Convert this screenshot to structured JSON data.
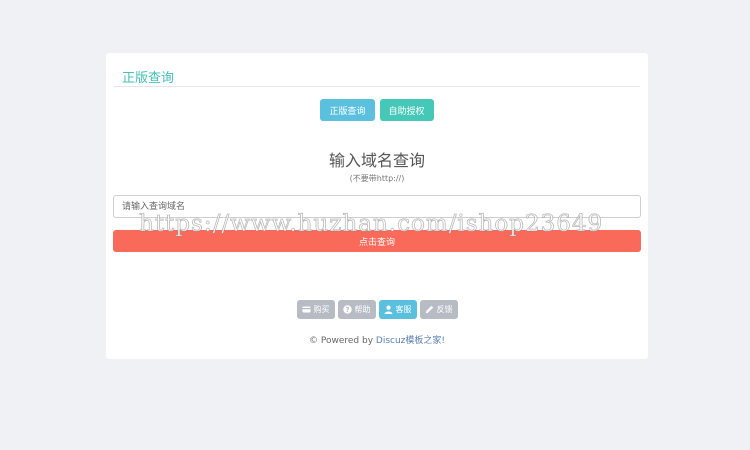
{
  "panel": {
    "title": "正版查询"
  },
  "tabs": [
    {
      "label": "正版查询"
    },
    {
      "label": "自助授权"
    }
  ],
  "query": {
    "heading": "输入域名查询",
    "hint": "(不要带http://)",
    "placeholder": "请输入查询域名",
    "value": "",
    "submit_label": "点击查询"
  },
  "footer": {
    "links": [
      {
        "label": "购买",
        "icon": "card-icon"
      },
      {
        "label": "帮助",
        "icon": "question-icon"
      },
      {
        "label": "客服",
        "icon": "user-icon"
      },
      {
        "label": "反馈",
        "icon": "pencil-icon"
      }
    ],
    "powered_prefix": "© Powered by ",
    "powered_brand": "Discuz模板之家!"
  },
  "watermark": "https://www.huzhan.com/ishop23649",
  "colors": {
    "page_bg": "#f0f1f5",
    "title": "#46bfb5",
    "tab_query": "#5bc0de",
    "tab_auth": "#46c8b8",
    "submit": "#f96a5a",
    "footer_gray": "#b7bcc4",
    "footer_active": "#5bc0de"
  }
}
